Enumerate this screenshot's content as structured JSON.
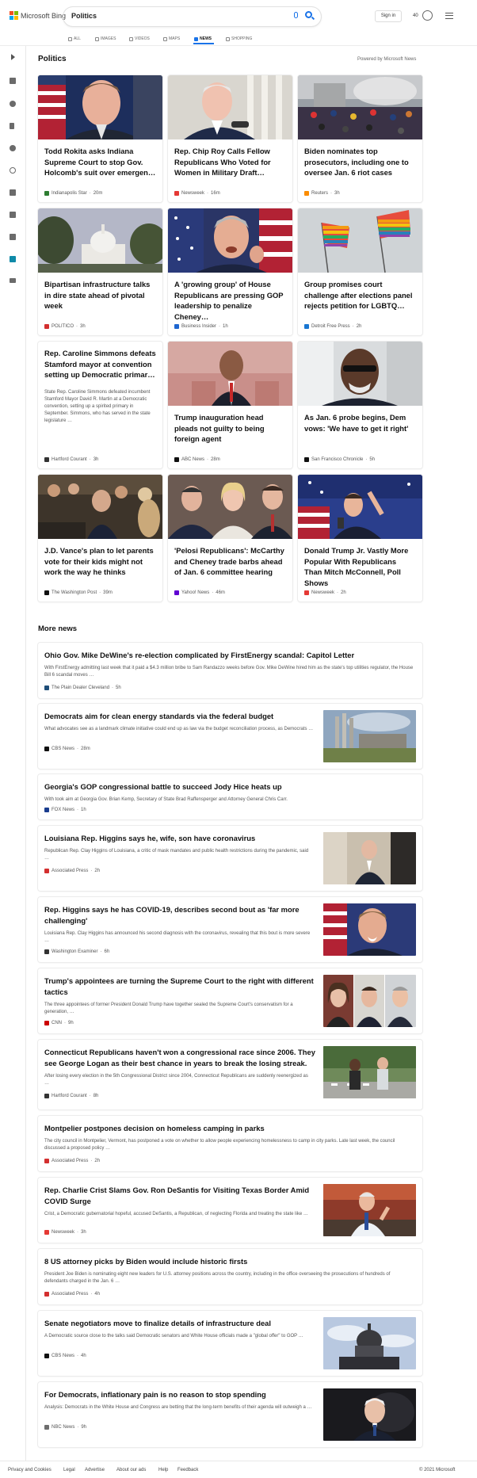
{
  "header": {
    "brand": "Microsoft Bing",
    "brand_colors": [
      "#f25022",
      "#7fba00",
      "#00a4ef",
      "#ffb900"
    ],
    "search_query": "Politics",
    "signin_label": "Sign in",
    "rewards_count": "40"
  },
  "tabs": [
    {
      "label": "ALL",
      "icon": "search-icon"
    },
    {
      "label": "IMAGES",
      "icon": "image-icon"
    },
    {
      "label": "VIDEOS",
      "icon": "video-icon"
    },
    {
      "label": "MAPS",
      "icon": "map-pin-icon"
    },
    {
      "label": "NEWS",
      "icon": "news-icon",
      "active": true
    },
    {
      "label": "SHOPPING",
      "icon": "shopping-icon"
    }
  ],
  "rail_icons": [
    "expand-icon",
    "home-icon",
    "trending-icon",
    "flag-icon",
    "location-icon",
    "globe-icon",
    "flask-icon",
    "rocket-icon",
    "film-icon",
    "politics-icon",
    "money-icon"
  ],
  "section": {
    "title": "Politics",
    "powered_by": "Powered by Microsoft News"
  },
  "cards": [
    {
      "title": "Todd Rokita asks Indiana Supreme Court to stop Gov. Holcomb's suit over emergen…",
      "source": "Indianapolis Star",
      "age": "20m",
      "logo_color": "#2e7d32"
    },
    {
      "title": "Rep. Chip Roy Calls Fellow Republicans Who Voted for Women in Military Draft…",
      "source": "Newsweek",
      "age": "16m",
      "logo_color": "#e53935"
    },
    {
      "title": "Biden nominates top prosecutors, including one to oversee Jan. 6 riot cases",
      "source": "Reuters",
      "age": "3h",
      "logo_color": "#fb8c00"
    },
    {
      "title": "Bipartisan infrastructure talks in dire state ahead of pivotal week",
      "source": "POLITICO",
      "age": "3h",
      "logo_color": "#d32f2f"
    },
    {
      "title": "A 'growing group' of House Republicans are pressing GOP leadership to penalize Cheney…",
      "source": "Business Insider",
      "age": "1h",
      "logo_color": "#1e66d0"
    },
    {
      "title": "Group promises court challenge after elections panel rejects petition for LGBTQ…",
      "source": "Detroit Free Press",
      "age": "2h",
      "logo_color": "#1976d2"
    },
    {
      "title": "Rep. Caroline Simmons defeats Stamford mayor at convention setting up Democratic primar…",
      "snippet": "State Rep. Caroline Simmons defeated incumbent Stamford Mayor David R. Martin at a Democratic convention, setting up a spirited primary in September. Simmons, who has served in the state legislature …",
      "source": "Hartford Courant",
      "age": "3h",
      "logo_color": "#333333"
    },
    {
      "title": "Trump inauguration head pleads not guilty to being foreign agent",
      "source": "ABC News",
      "age": "28m",
      "logo_color": "#111111"
    },
    {
      "title": "As Jan. 6 probe begins, Dem vows: 'We have to get it right'",
      "source": "San Francisco Chronicle",
      "age": "5h",
      "logo_color": "#111111"
    },
    {
      "title": "J.D. Vance's plan to let parents vote for their kids might not work the way he thinks",
      "source": "The Washington Post",
      "age": "39m",
      "logo_color": "#111111"
    },
    {
      "title": "'Pelosi Republicans': McCarthy and Cheney trade barbs ahead of Jan. 6 committee hearing",
      "source": "Yahoo! News",
      "age": "46m",
      "logo_color": "#6001d2"
    },
    {
      "title": "Donald Trump Jr. Vastly More Popular With Republicans Than Mitch McConnell, Poll Shows",
      "source": "Newsweek",
      "age": "2h",
      "logo_color": "#e53935"
    }
  ],
  "more_news": {
    "title": "More news",
    "items": [
      {
        "title": "Ohio Gov. Mike DeWine's re-election complicated by FirstEnergy scandal: Capitol Letter",
        "snippet": "With FirstEnergy admitting last week that it paid a $4.3 million bribe to Sam Randazzo weeks before Gov. Mike DeWine hired him as the state's top utilities regulator, the House Bill 6 scandal moves …",
        "source": "The Plain Dealer Cleveland",
        "age": "5h",
        "logo_color": "#1f4e79"
      },
      {
        "title": "Democrats aim for clean energy standards via the federal budget",
        "snippet": "What advocates see as a landmark climate initiative could end up as law via the budget reconciliation process, as Democrats …",
        "source": "CBS News",
        "age": "28m",
        "logo_color": "#111111"
      },
      {
        "title": "Georgia's GOP congressional battle to succeed Jody Hice heats up",
        "snippet": "With took aim at Georgia Gov. Brian Kemp, Secretary of State Brad Raffensperger and Attorney General Chris Carr.",
        "source": "FOX News",
        "age": "1h",
        "logo_color": "#1a3d8f"
      },
      {
        "title": "Louisiana Rep. Higgins says he, wife, son have coronavirus",
        "snippet": "Republican Rep. Clay Higgins of Louisiana, a critic of mask mandates and public health restrictions during the pandemic, said …",
        "source": "Associated Press",
        "age": "2h",
        "logo_color": "#d32f2f"
      },
      {
        "title": "Rep. Higgins says he has COVID-19, describes second bout as 'far more challenging'",
        "snippet": "Louisiana Rep. Clay Higgins has announced his second diagnosis with the coronavirus, revealing that this bout is more severe …",
        "source": "Washington Examiner",
        "age": "6h",
        "logo_color": "#333333"
      },
      {
        "title": "Trump's appointees are turning the Supreme Court to the right with different tactics",
        "snippet": "The three appointees of former President Donald Trump have together sealed the Supreme Court's conservatism for a generation, …",
        "source": "CNN",
        "age": "9h",
        "logo_color": "#cc0000"
      },
      {
        "title": "Connecticut Republicans haven't won a congressional race since 2006. They see George Logan as their best chance in years to break the losing streak.",
        "snippet": "After losing every election in the 5th Congressional District since 2004, Connecticut Republicans are suddenly reenergized as …",
        "source": "Hartford Courant",
        "age": "8h",
        "logo_color": "#333333"
      },
      {
        "title": "Montpelier postpones decision on homeless camping in parks",
        "snippet": "The city council in Montpelier, Vermont, has postponed a vote on whether to allow people experiencing homelessness to camp in city parks. Late last week, the council discussed a proposed policy …",
        "source": "Associated Press",
        "age": "2h",
        "logo_color": "#d32f2f"
      },
      {
        "title": "Rep. Charlie Crist Slams Gov. Ron DeSantis for Visiting Texas Border Amid COVID Surge",
        "snippet": "Crist, a Democratic gubernatorial hopeful, accused DeSantis, a Republican, of neglecting Florida and treating the state like …",
        "source": "Newsweek",
        "age": "3h",
        "logo_color": "#e53935"
      },
      {
        "title": "8 US attorney picks by Biden would include historic firsts",
        "snippet": "President Joe Biden is nominating eight new leaders for U.S. attorney positions across the country, including in the office overseeing the prosecutions of hundreds of defendants charged in the Jan. 6 …",
        "source": "Associated Press",
        "age": "4h",
        "logo_color": "#d32f2f"
      },
      {
        "title": "Senate negotiators move to finalize details of infrastructure deal",
        "snippet": "A Democratic source close to the talks said Democratic senators and White House officials made a \"global offer\" to GOP …",
        "source": "CBS News",
        "age": "4h",
        "logo_color": "#111111"
      },
      {
        "title": "For Democrats, inflationary pain is no reason to stop spending",
        "snippet": "Analysis: Democrats in the White House and Congress are betting that the long-term benefits of their agenda will outweigh a …",
        "source": "NBC News",
        "age": "9h",
        "logo_color": "#6e6e6e"
      }
    ]
  },
  "footer": {
    "links": [
      "Privacy and Cookies",
      "Legal",
      "Advertise",
      "About our ads",
      "Help",
      "Feedback"
    ],
    "copyright": "© 2021 Microsoft"
  }
}
